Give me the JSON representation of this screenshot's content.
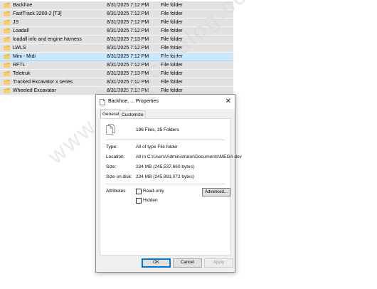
{
  "file_list": {
    "rows": [
      {
        "name": "Backhoe",
        "date": "8/31/2025 7:12 PM",
        "type": "File folder",
        "selected": false
      },
      {
        "name": "FastTrack 3200-2 [T3]",
        "date": "8/31/2025 7:12 PM",
        "type": "File folder",
        "selected": false
      },
      {
        "name": "JS",
        "date": "8/31/2025 7:12 PM",
        "type": "File folder",
        "selected": false
      },
      {
        "name": "Loadall",
        "date": "8/31/2025 7:12 PM",
        "type": "File folder",
        "selected": false
      },
      {
        "name": "loadall info and engine harness",
        "date": "8/31/2025 7:13 PM",
        "type": "File folder",
        "selected": false
      },
      {
        "name": "LWLS",
        "date": "8/31/2025 7:12 PM",
        "type": "File folder",
        "selected": false
      },
      {
        "name": "Mini - Midi",
        "date": "8/31/2025 7:12 PM",
        "type": "File folder",
        "selected": true
      },
      {
        "name": "RFTL",
        "date": "8/31/2025 7:12 PM",
        "type": "File folder",
        "selected": false
      },
      {
        "name": "Teletruk",
        "date": "8/31/2025 7:13 PM",
        "type": "File folder",
        "selected": false
      },
      {
        "name": "Tracked Excavator x series",
        "date": "8/31/2025 7:12 PM",
        "type": "File folder",
        "selected": false
      },
      {
        "name": "Wheeled Excavator",
        "date": "8/31/2025 7:12 PM",
        "type": "File folder",
        "selected": false
      }
    ]
  },
  "dialog": {
    "title": "Backhoe, ... Properties",
    "close_glyph": "✕",
    "tabs": [
      {
        "label": "General",
        "active": true
      },
      {
        "label": "Customize",
        "active": false
      }
    ],
    "summary": "196 Files, 35 Folders",
    "fields": {
      "type_label": "Type:",
      "type_value": "All of type File folder",
      "location_label": "Location:",
      "location_value": "All in C:\\Users\\Administrator\\Documents\\MEGA dov",
      "size_label": "Size:",
      "size_value": "234 MB (245,537,660 bytes)",
      "size_on_disk_label": "Size on disk:",
      "size_on_disk_value": "234 MB (245,891,072 bytes)"
    },
    "attributes": {
      "label": "Attributes",
      "read_only_label": "Read-only",
      "read_only_checked": false,
      "hidden_label": "Hidden",
      "hidden_checked": false,
      "advanced_label": "Advanced..."
    },
    "buttons": {
      "ok": "OK",
      "cancel": "Cancel",
      "apply": "Apply"
    }
  },
  "watermark": "www.autopcatalog.com",
  "colors": {
    "folder": "#e8b84a",
    "selection": "#cce8ff",
    "row_background": "#e2e2e2",
    "dialog_background": "#f0f0f0",
    "accent": "#0078d7"
  }
}
